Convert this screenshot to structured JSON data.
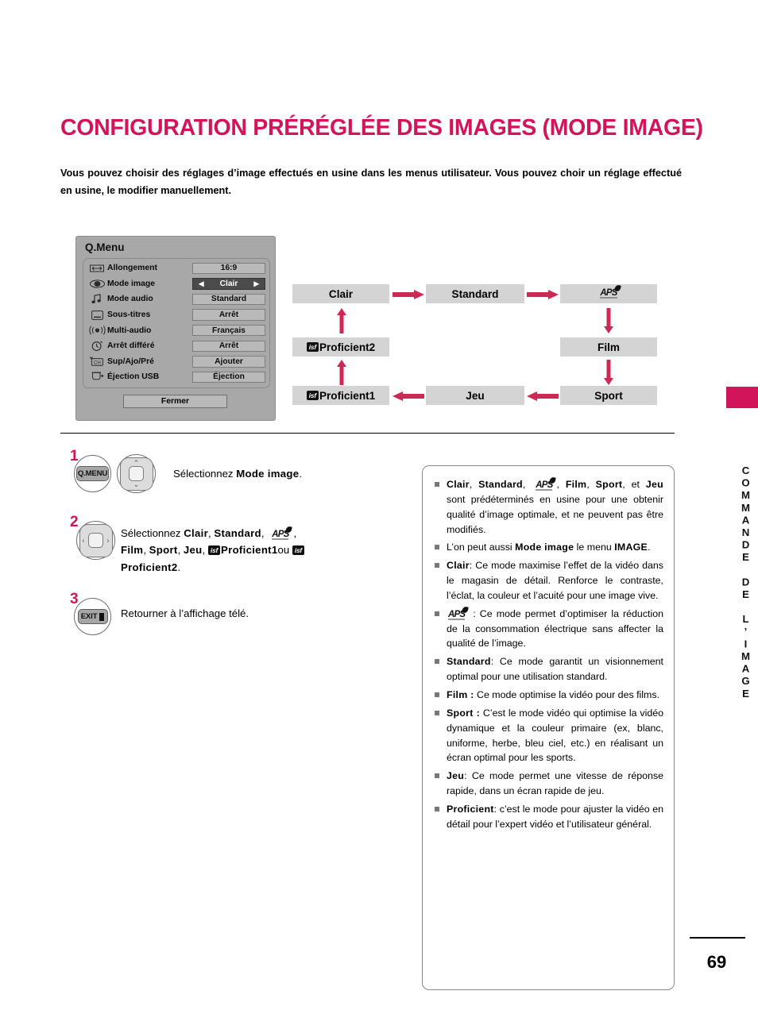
{
  "page": {
    "title": "CONFIGURATION PRÉRÉGLÉE DES IMAGES (MODE IMAGE)",
    "intro": "Vous pouvez choisir des réglages d’image effectués en usine dans les menus utilisateur. Vous pouvez choir un réglage effectué en usine, le modifier manuellement.",
    "number": "69",
    "side_tab_label": "COMMANDE DE L’IMAGE",
    "accent_color": "#d2145a"
  },
  "qmenu": {
    "title": "Q.Menu",
    "close_label": "Fermer",
    "rows": [
      {
        "icon": "stretch-arrows-icon",
        "label": "Allongement",
        "value": "16:9",
        "selected": false
      },
      {
        "icon": "eye-icon",
        "label": "Mode image",
        "value": "Clair",
        "selected": true,
        "left_arrow": "◀",
        "right_arrow": "▶"
      },
      {
        "icon": "music-note-icon",
        "label": "Mode audio",
        "value": "Standard",
        "selected": false
      },
      {
        "icon": "subtitle-box-icon",
        "label": "Sous-titres",
        "value": "Arrêt",
        "selected": false
      },
      {
        "icon": "multi-audio-icon",
        "label": "Multi-audio",
        "value": "Français",
        "selected": false
      },
      {
        "icon": "sleep-timer-icon",
        "label": "Arrêt différé",
        "value": "Arrêt",
        "selected": false
      },
      {
        "icon": "channel-edit-icon",
        "label": "Sup/Ajo/Pré",
        "value": "Ajouter",
        "selected": false
      },
      {
        "icon": "usb-eject-icon",
        "label": "Éjection USB",
        "value": "Éjection",
        "selected": false
      }
    ]
  },
  "flow": {
    "boxes": {
      "clair": "Clair",
      "standard": "Standard",
      "aps": "APS",
      "film": "Film",
      "sport": "Sport",
      "jeu": "Jeu",
      "proficient1": "Proficient1",
      "proficient2": "Proficient2",
      "isf_badge": "isf"
    },
    "arrow_color": "#cc2a55"
  },
  "steps": [
    {
      "number": "1",
      "keys": [
        "Q.MENU",
        "nav-up-down"
      ],
      "key_label": "Q.MENU",
      "text_prefix": "Sélectionnez ",
      "text_bold": "Mode image",
      "text_suffix": "."
    },
    {
      "number": "2",
      "keys": [
        "nav-left-right"
      ],
      "text": "Sélectionnez Clair, Standard, APS, Film, Sport, Jeu, isf Proficient1 ou isf Proficient2."
    },
    {
      "number": "3",
      "keys": [
        "EXIT"
      ],
      "key_label": "EXIT",
      "text": "Retourner à l’affichage télé."
    }
  ],
  "notes": [
    "Clair, Standard, APS, Film, Sport, et Jeu sont prédéterminés en usine pour une obtenir qualité d’image optimale, et ne peuvent pas être modifiés.",
    "L’on peut aussi Mode image le menu IMAGE.",
    "Clair: Ce mode maximise l’effet de la vidéo dans le magasin de détail. Renforce le contraste, l’éclat, la couleur et l’acuité pour une image vive.",
    "APS : Ce mode permet d’optimiser la réduction de la consommation électrique sans affecter la qualité de l’image.",
    "Standard: Ce mode garantit un visionnement optimal pour une utilisation standard.",
    "Film : Ce mode optimise la vidéo pour des films.",
    "Sport : C’est le mode vidéo qui optimise la vidéo dynamique et la couleur primaire (ex, blanc, uniforme, herbe, bleu ciel, etc.) en réalisant un écran optimal pour les sports.",
    "Jeu: Ce mode permet une vitesse de réponse rapide, dans un écran rapide de jeu.",
    "Proficient: c’est le mode pour ajuster la vidéo en détail pour l’expert vidéo et l’utilisateur général."
  ]
}
